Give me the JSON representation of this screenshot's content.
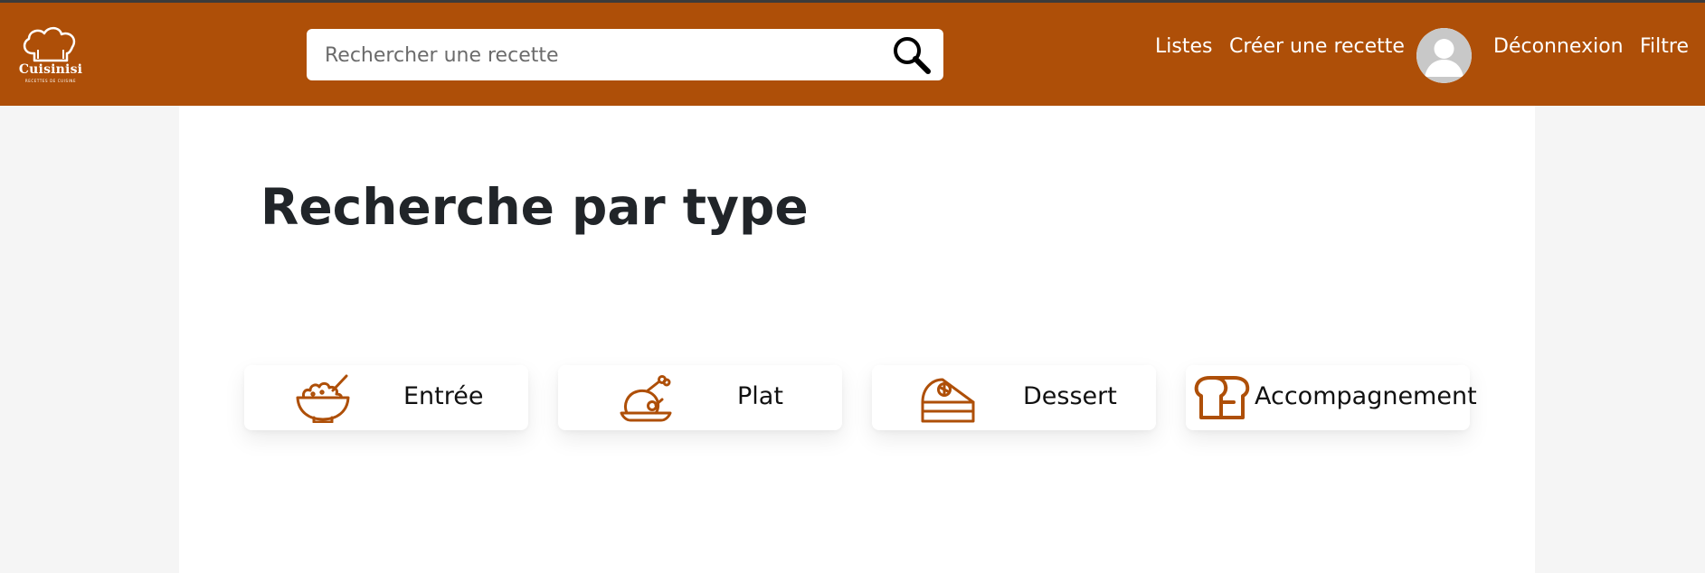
{
  "header": {
    "logo": {
      "name": "Cuisinisi",
      "tagline": "RECETTES DE CUISINE"
    },
    "search": {
      "placeholder": "Rechercher une recette",
      "value": "",
      "icon": "search-icon"
    },
    "nav": {
      "listes": "Listes",
      "creer": "Créer une recette",
      "deconnexion": "Déconnexion",
      "filtre": "Filtre"
    },
    "avatar": {
      "icon": "user-avatar-icon"
    }
  },
  "main": {
    "title": "Recherche par type",
    "categories": [
      {
        "label": "Entrée",
        "icon": "salad-bowl-icon"
      },
      {
        "label": "Plat",
        "icon": "roast-chicken-icon"
      },
      {
        "label": "Dessert",
        "icon": "cake-slice-icon"
      },
      {
        "label": "Accompagnement",
        "icon": "bread-icon"
      }
    ]
  },
  "colors": {
    "brand": "#ae4f08",
    "page_background": "#f5f5f5",
    "content_background": "#ffffff",
    "title_text": "#212529"
  }
}
